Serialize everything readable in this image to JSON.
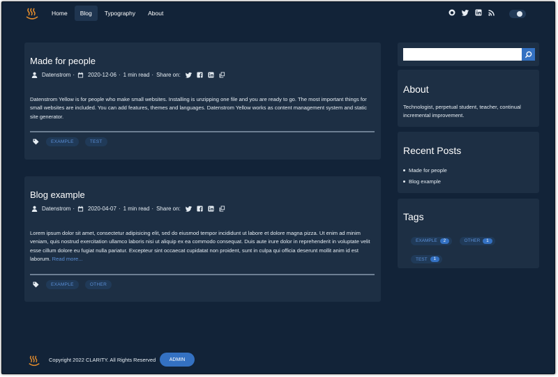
{
  "nav": {
    "items": [
      {
        "label": "Home"
      },
      {
        "label": "Blog",
        "active": true
      },
      {
        "label": "Typography"
      },
      {
        "label": "About"
      }
    ]
  },
  "header": {
    "social_icons": [
      "github-icon",
      "twitter-icon",
      "linkedin-icon",
      "rss-icon"
    ],
    "theme_toggle": "dark-mode-toggle"
  },
  "posts": [
    {
      "title": "Made for people",
      "author": "Datenstrom",
      "date": "2020-12-06",
      "read_time": "1 min read",
      "share_label": "Share on:",
      "excerpt": "Datenstrom Yellow is for people who make small websites. Installing is unzipping one file and you are ready to go. The most important things for small websites are included. You can add features, themes and languages. Datenstrom Yellow works as content management system and static site generator.",
      "read_more": "",
      "tags": [
        "EXAMPLE",
        "TEST"
      ]
    },
    {
      "title": "Blog example",
      "author": "Datenstrom",
      "date": "2020-04-07",
      "read_time": "1 min read",
      "share_label": "Share on:",
      "excerpt": "Lorem ipsum dolor sit amet, consectetur adipisicing elit, sed do eiusmod tempor incididunt ut labore et dolore magna pizza. Ut enim ad minim veniam, quis nostrud exercitation ullamco laboris nisi ut aliquip ex ea commodo consequat. Duis aute irure dolor in reprehenderit in voluptate velit esse cillum dolore eu fugiat nulla pariatur. Excepteur sint occaecat cupidatat non proident, sunt in culpa qui officia deserunt mollit anim id est laborum.",
      "read_more": "Read more...",
      "tags": [
        "EXAMPLE",
        "OTHER"
      ]
    }
  ],
  "sidebar": {
    "search": {
      "value": "",
      "placeholder": ""
    },
    "about": {
      "title": "About",
      "text": "Technologist, perpetual student, teacher, continual incremental improvement."
    },
    "recent": {
      "title": "Recent Posts",
      "items": [
        "Made for people",
        "Blog example"
      ]
    },
    "tags": {
      "title": "Tags",
      "items": [
        {
          "label": "EXAMPLE",
          "count": "2"
        },
        {
          "label": "OTHER",
          "count": "1"
        },
        {
          "label": "TEST",
          "count": "1"
        }
      ]
    }
  },
  "footer": {
    "copyright": "Copyright 2022 CLARITY. All Rights Reserved",
    "admin_label": "ADMIN"
  },
  "colors": {
    "page_bg": "#122338",
    "card_bg": "#1d2f44",
    "accent": "#3471c2",
    "link": "#5b8fd6",
    "logo": "#e08a2c"
  }
}
